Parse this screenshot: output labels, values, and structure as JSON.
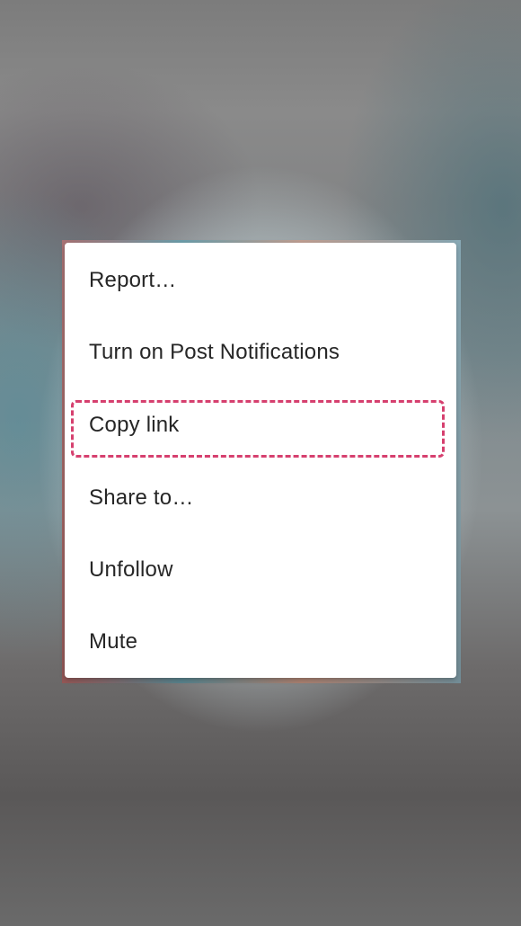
{
  "menu": {
    "items": [
      {
        "label": "Report…"
      },
      {
        "label": "Turn on Post Notifications"
      },
      {
        "label": "Copy link"
      },
      {
        "label": "Share to…"
      },
      {
        "label": "Unfollow"
      },
      {
        "label": "Mute"
      }
    ],
    "highlighted_item_index": 2,
    "highlight_color": "#d6406f"
  }
}
